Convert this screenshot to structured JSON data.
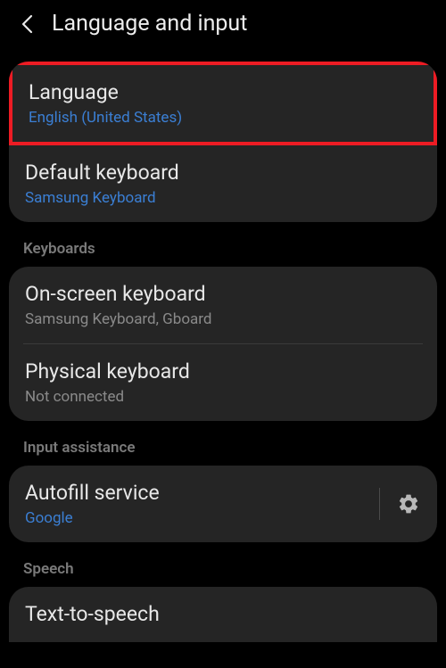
{
  "header": {
    "title": "Language and input"
  },
  "general": {
    "language": {
      "title": "Language",
      "value": "English (United States)"
    },
    "defaultKeyboard": {
      "title": "Default keyboard",
      "value": "Samsung Keyboard"
    }
  },
  "sections": {
    "keyboards": {
      "label": "Keyboards",
      "onScreen": {
        "title": "On-screen keyboard",
        "value": "Samsung Keyboard, Gboard"
      },
      "physical": {
        "title": "Physical keyboard",
        "value": "Not connected"
      }
    },
    "inputAssistance": {
      "label": "Input assistance",
      "autofill": {
        "title": "Autofill service",
        "value": "Google"
      }
    },
    "speech": {
      "label": "Speech",
      "tts": {
        "title": "Text-to-speech"
      }
    }
  }
}
